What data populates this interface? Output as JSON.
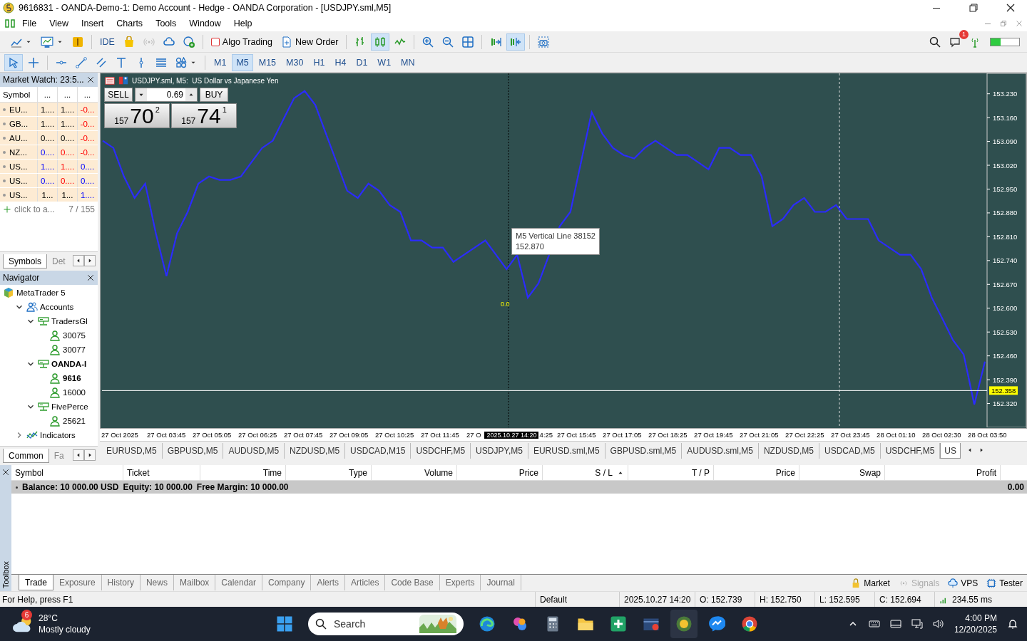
{
  "window": {
    "title": "9616831 - OANDA-Demo-1: Demo Account - Hedge - OANDA Corporation - [USDJPY.sml,M5]"
  },
  "menu": [
    "File",
    "View",
    "Insert",
    "Charts",
    "Tools",
    "Window",
    "Help"
  ],
  "toolbar": {
    "ide": "IDE",
    "algo_trading": {
      "label": "Algo Trading",
      "on": false
    },
    "new_order": "New Order",
    "notification_badge": "1"
  },
  "timeframes": [
    {
      "label": "M1",
      "selected": false
    },
    {
      "label": "M5",
      "selected": true
    },
    {
      "label": "M15",
      "selected": false
    },
    {
      "label": "M30",
      "selected": false
    },
    {
      "label": "H1",
      "selected": false
    },
    {
      "label": "H4",
      "selected": false
    },
    {
      "label": "D1",
      "selected": false
    },
    {
      "label": "W1",
      "selected": false
    },
    {
      "label": "MN",
      "selected": false
    }
  ],
  "market_watch": {
    "title": "Market Watch: 23:5...",
    "columns": [
      "Symbol",
      "...",
      "...",
      "..."
    ],
    "rows": [
      {
        "cells": [
          "EU...",
          {
            "text": "1....",
            "up": false,
            "down": false
          },
          {
            "text": "1....",
            "up": false,
            "down": false
          },
          {
            "text": "-0...",
            "up": false,
            "down": true
          }
        ]
      },
      {
        "cells": [
          "GB...",
          {
            "text": "1....",
            "up": false,
            "down": false
          },
          {
            "text": "1....",
            "up": false,
            "down": false
          },
          {
            "text": "-0...",
            "up": false,
            "down": true
          }
        ]
      },
      {
        "cells": [
          "AU...",
          {
            "text": "0....",
            "up": false,
            "down": false
          },
          {
            "text": "0....",
            "up": false,
            "down": false
          },
          {
            "text": "-0...",
            "up": false,
            "down": true
          }
        ]
      },
      {
        "cells": [
          "NZ...",
          {
            "text": "0....",
            "up": true,
            "down": false
          },
          {
            "text": "0....",
            "up": false,
            "down": true
          },
          {
            "text": "-0...",
            "up": false,
            "down": true
          }
        ]
      },
      {
        "cells": [
          "US...",
          {
            "text": "1....",
            "up": true,
            "down": false
          },
          {
            "text": "1....",
            "up": false,
            "down": true
          },
          {
            "text": "0....",
            "up": true,
            "down": false
          }
        ]
      },
      {
        "cells": [
          "US...",
          {
            "text": "0....",
            "up": true,
            "down": false
          },
          {
            "text": "0....",
            "up": false,
            "down": true
          },
          {
            "text": "0....",
            "up": true,
            "down": false
          }
        ]
      },
      {
        "cells": [
          "US...",
          {
            "text": "1...",
            "up": false,
            "down": false
          },
          {
            "text": "1...",
            "up": false,
            "down": false
          },
          {
            "text": "1....",
            "up": true,
            "down": false
          }
        ]
      }
    ],
    "add_hint": "click to a...",
    "count": "7 / 155",
    "tabs": [
      {
        "label": "Symbols",
        "selected": true
      },
      {
        "label": "Det",
        "selected": false
      }
    ]
  },
  "navigator": {
    "title": "Navigator",
    "tree": [
      {
        "label": "MetaTrader 5",
        "kind": "root",
        "children": [
          {
            "label": "Accounts",
            "kind": "accounts",
            "expanded": true,
            "children": [
              {
                "label": "TradersGl",
                "kind": "server",
                "expanded": true,
                "current": false,
                "children": [
                  {
                    "label": "30075",
                    "kind": "account",
                    "current": false
                  },
                  {
                    "label": "30077",
                    "kind": "account",
                    "current": false
                  }
                ]
              },
              {
                "label": "OANDA-I",
                "kind": "server",
                "expanded": true,
                "current": true,
                "children": [
                  {
                    "label": "9616",
                    "kind": "account",
                    "current": true
                  },
                  {
                    "label": "16000",
                    "kind": "account",
                    "current": false
                  }
                ]
              },
              {
                "label": "FivePerce",
                "kind": "server",
                "expanded": true,
                "current": false,
                "children": [
                  {
                    "label": "25621",
                    "kind": "account",
                    "current": false
                  }
                ]
              }
            ]
          },
          {
            "label": "Indicators",
            "kind": "indicators",
            "expanded": false
          }
        ]
      }
    ],
    "tabs": [
      {
        "label": "Common",
        "selected": true
      },
      {
        "label": "Fa",
        "selected": false
      }
    ]
  },
  "chart": {
    "header": "USDJPY.sml, M5:  US Dollar vs Japanese Yen",
    "trade_panel": {
      "sell": "SELL",
      "buy": "BUY",
      "volume": "0.69",
      "bid": {
        "big": "157",
        "main": "70",
        "small": "2"
      },
      "ask": {
        "big": "157",
        "main": "74",
        "small": "1"
      }
    },
    "chart_data": {
      "type": "line",
      "ylim": [
        152.25,
        153.29
      ],
      "yticks": [
        {
          "value": 153.23,
          "label": "153.230"
        },
        {
          "value": 153.16,
          "label": "153.160"
        },
        {
          "value": 153.09,
          "label": "153.090"
        },
        {
          "value": 153.02,
          "label": "153.020"
        },
        {
          "value": 152.95,
          "label": "152.950"
        },
        {
          "value": 152.88,
          "label": "152.880"
        },
        {
          "value": 152.81,
          "label": "152.810"
        },
        {
          "value": 152.74,
          "label": "152.740"
        },
        {
          "value": 152.67,
          "label": "152.670"
        },
        {
          "value": 152.6,
          "label": "152.600"
        },
        {
          "value": 152.53,
          "label": "152.530"
        },
        {
          "value": 152.46,
          "label": "152.460"
        },
        {
          "value": 152.39,
          "label": "152.390"
        },
        {
          "value": 152.32,
          "label": "152.320"
        }
      ],
      "ref_lines": [
        {
          "axis": "y",
          "value": 152.358,
          "label": "152.358",
          "color": "#ffffff"
        }
      ],
      "series": [
        {
          "color": "#2b2bff",
          "values": [
            153.092,
            153.071,
            152.987,
            152.924,
            152.966,
            152.82,
            152.694,
            152.82,
            152.883,
            152.966,
            152.987,
            152.977,
            152.977,
            152.987,
            153.029,
            153.071,
            153.092,
            153.155,
            153.217,
            153.238,
            153.197,
            153.113,
            153.029,
            152.945,
            152.924,
            152.966,
            152.945,
            152.903,
            152.883,
            152.799,
            152.799,
            152.778,
            152.778,
            152.736,
            152.757,
            152.778,
            152.799,
            152.757,
            152.715,
            152.757,
            152.631,
            152.673,
            152.757,
            152.841,
            152.883,
            153.029,
            153.176,
            153.113,
            153.071,
            153.05,
            153.04,
            153.071,
            153.092,
            153.071,
            153.05,
            153.05,
            153.029,
            153.008,
            153.071,
            153.071,
            153.05,
            153.05,
            152.987,
            152.841,
            152.862,
            152.903,
            152.924,
            152.883,
            152.883,
            152.903,
            152.862,
            152.862,
            152.862,
            152.799,
            152.778,
            152.757,
            152.757,
            152.715,
            152.631,
            152.569,
            152.506,
            152.464,
            152.317,
            152.443
          ]
        }
      ]
    },
    "marker": "0.0",
    "vertical_line": {
      "lines": [
        "M5 Vertical Line 38152",
        "152.870"
      ]
    },
    "time_axis": [
      {
        "text": "27 Oct 2025",
        "kind": "tick"
      },
      {
        "text": "27 Oct 03:45",
        "kind": "tick"
      },
      {
        "text": "27 Oct 05:05",
        "kind": "tick"
      },
      {
        "text": "27 Oct 06:25",
        "kind": "tick"
      },
      {
        "text": "27 Oct 07:45",
        "kind": "tick"
      },
      {
        "text": "27 Oct 09:05",
        "kind": "tick"
      },
      {
        "text": "27 Oct 10:25",
        "kind": "tick"
      },
      {
        "text": "27 Oct 11:45",
        "kind": "tick"
      },
      {
        "text": "27 O",
        "kind": "partial"
      },
      {
        "text": "2025.10.27 14:20",
        "kind": "crosshair"
      },
      {
        "text": "4:25",
        "kind": "partial"
      },
      {
        "text": "27 Oct 15:45",
        "kind": "tick"
      },
      {
        "text": "27 Oct 17:05",
        "kind": "tick"
      },
      {
        "text": "27 Oct 18:25",
        "kind": "tick"
      },
      {
        "text": "27 Oct 19:45",
        "kind": "tick"
      },
      {
        "text": "27 Oct 21:05",
        "kind": "tick"
      },
      {
        "text": "27 Oct 22:25",
        "kind": "tick"
      },
      {
        "text": "27 Oct 23:45",
        "kind": "tick"
      },
      {
        "text": "28 Oct 01:10",
        "kind": "tick"
      },
      {
        "text": "28 Oct 02:30",
        "kind": "tick"
      },
      {
        "text": "28 Oct 03:50",
        "kind": "tick"
      }
    ]
  },
  "chart_tabs": [
    {
      "label": "EURUSD,M5",
      "selected": false
    },
    {
      "label": "GBPUSD,M5",
      "selected": false
    },
    {
      "label": "AUDUSD,M5",
      "selected": false
    },
    {
      "label": "NZDUSD,M5",
      "selected": false
    },
    {
      "label": "USDCAD,M15",
      "selected": false
    },
    {
      "label": "USDCHF,M5",
      "selected": false
    },
    {
      "label": "USDJPY,M5",
      "selected": false
    },
    {
      "label": "EURUSD.sml,M5",
      "selected": false
    },
    {
      "label": "GBPUSD.sml,M5",
      "selected": false
    },
    {
      "label": "AUDUSD.sml,M5",
      "selected": false
    },
    {
      "label": "NZDUSD,M5",
      "selected": false
    },
    {
      "label": "USDCAD,M5",
      "selected": false
    },
    {
      "label": "USDCHF,M5",
      "selected": false
    },
    {
      "label": "US",
      "selected": true
    }
  ],
  "toolbox": {
    "side_label": "Toolbox",
    "columns": [
      {
        "label": "Symbol",
        "sorted": false
      },
      {
        "label": "Ticket",
        "sorted": false
      },
      {
        "label": "Time",
        "sorted": false
      },
      {
        "label": "Type",
        "sorted": false
      },
      {
        "label": "Volume",
        "sorted": false
      },
      {
        "label": "Price",
        "sorted": false
      },
      {
        "label": "S / L",
        "sorted": true
      },
      {
        "label": "T / P",
        "sorted": false
      },
      {
        "label": "Price",
        "sorted": false
      },
      {
        "label": "Swap",
        "sorted": false
      },
      {
        "label": "Profit",
        "sorted": false
      }
    ],
    "summary": [
      "Balance: 10 000.00 USD",
      "Equity: 10 000.00",
      "Free Margin: 10 000.00"
    ],
    "profit": "0.00",
    "tabs": [
      {
        "label": "Trade",
        "selected": true
      },
      {
        "label": "Exposure",
        "selected": false
      },
      {
        "label": "History",
        "selected": false
      },
      {
        "label": "News",
        "selected": false
      },
      {
        "label": "Mailbox",
        "selected": false
      },
      {
        "label": "Calendar",
        "selected": false
      },
      {
        "label": "Company",
        "selected": false
      },
      {
        "label": "Alerts",
        "selected": false
      },
      {
        "label": "Articles",
        "selected": false
      },
      {
        "label": "Code Base",
        "selected": false
      },
      {
        "label": "Experts",
        "selected": false
      },
      {
        "label": "Journal",
        "selected": false
      }
    ],
    "services": [
      {
        "label": "Market",
        "kind": "market",
        "disabled": false
      },
      {
        "label": "Signals",
        "kind": "signals",
        "disabled": true
      },
      {
        "label": "VPS",
        "kind": "vps",
        "disabled": false
      },
      {
        "label": "Tester",
        "kind": "tester",
        "disabled": false
      }
    ]
  },
  "status_bar": {
    "help": "For Help, press F1",
    "fields": [
      "Default",
      "2025.10.27 14:20",
      "O: 152.739",
      "H: 152.750",
      "L: 152.595",
      "C: 152.694"
    ],
    "ping": "234.55 ms"
  },
  "taskbar": {
    "weather": {
      "badge": "6",
      "temperature": "28°C",
      "condition": "Mostly cloudy"
    },
    "search": {
      "placeholder": "Search"
    },
    "clock": {
      "time": "4:00 PM",
      "date": "12/20/2025"
    }
  }
}
